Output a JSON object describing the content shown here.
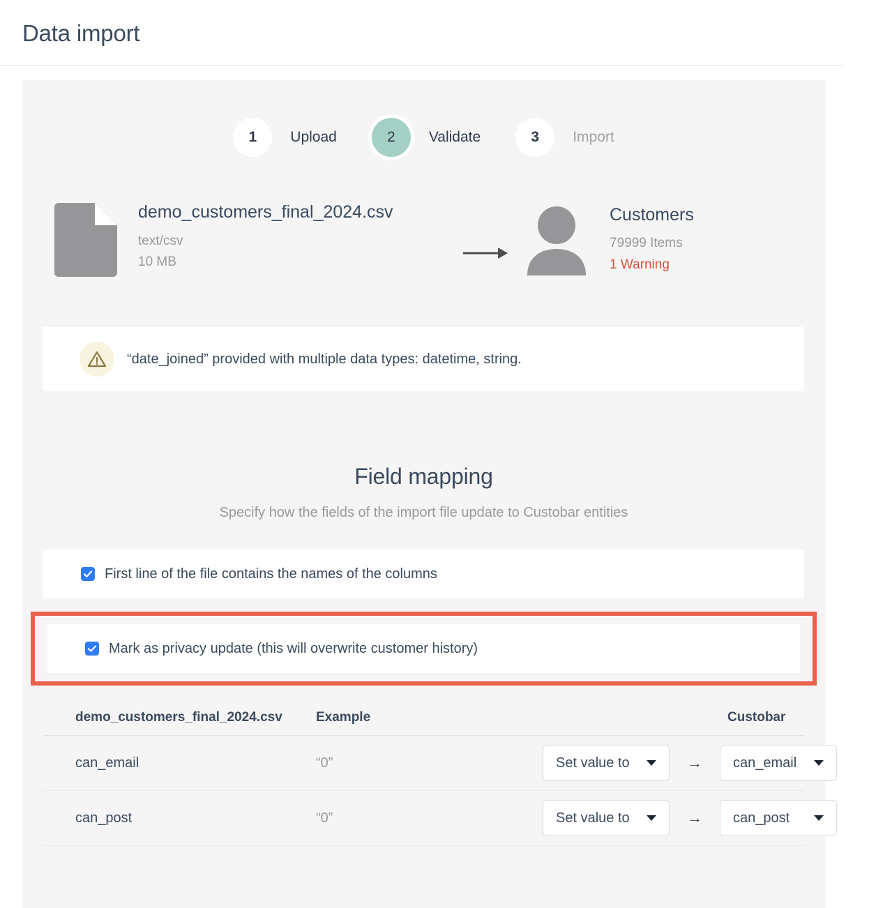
{
  "header": {
    "title": "Data import"
  },
  "stepper": {
    "steps": [
      {
        "number": "1",
        "label": "Upload",
        "state": "done"
      },
      {
        "number": "2",
        "label": "Validate",
        "state": "active"
      },
      {
        "number": "3",
        "label": "Import",
        "state": "pending"
      }
    ],
    "active_color": "#a4d0c5"
  },
  "summary": {
    "file": {
      "name": "demo_customers_final_2024.csv",
      "mime": "text/csv",
      "size": "10 MB",
      "icon": "file-icon"
    },
    "arrow_icon": "arrow-right-icon",
    "target": {
      "icon": "person-icon",
      "name": "Customers",
      "items": "79999 Items",
      "warning": "1 Warning",
      "warning_color": "#d8503a"
    }
  },
  "warning_banner": {
    "icon": "warning-triangle-icon",
    "text": "“date_joined” provided with multiple data types: datetime, string."
  },
  "field_mapping": {
    "title": "Field mapping",
    "subtitle": "Specify how the fields of the import file update to Custobar entities",
    "options": [
      {
        "label": "First line of the file contains the names of the columns",
        "checked": true,
        "highlighted": false
      },
      {
        "label": "Mark as privacy update (this will overwrite customer history)",
        "checked": true,
        "highlighted": true
      }
    ],
    "highlight_color": "#e8614c",
    "columns": {
      "source": "demo_customers_final_2024.csv",
      "example": "Example",
      "custobar": "Custobar"
    },
    "rows": [
      {
        "source": "can_email",
        "example": "“0”",
        "action": "Set value to",
        "arrow": "→",
        "target": "can_email"
      },
      {
        "source": "can_post",
        "example": "“0”",
        "action": "Set value to",
        "arrow": "→",
        "target": "can_post"
      }
    ]
  }
}
